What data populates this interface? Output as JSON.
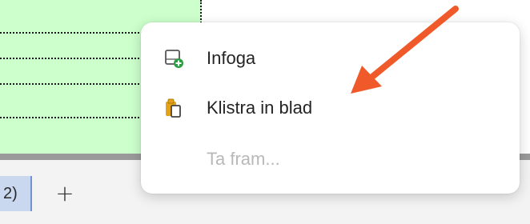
{
  "sheet_tabs": {
    "active_tab_fragment": "2)",
    "add_label": "+"
  },
  "context_menu": {
    "items": [
      {
        "label": "Infoga",
        "icon": "insert-sheet-icon",
        "enabled": true
      },
      {
        "label": "Klistra in blad",
        "icon": "paste-sheet-icon",
        "enabled": true
      },
      {
        "label": "Ta fram...",
        "icon": "",
        "enabled": false
      }
    ]
  },
  "colors": {
    "cell_highlight": "#ccffcc",
    "arrow": "#f05a2a",
    "insert_icon_accent": "#2e9e44",
    "paste_icon_accent": "#e3a21a"
  }
}
